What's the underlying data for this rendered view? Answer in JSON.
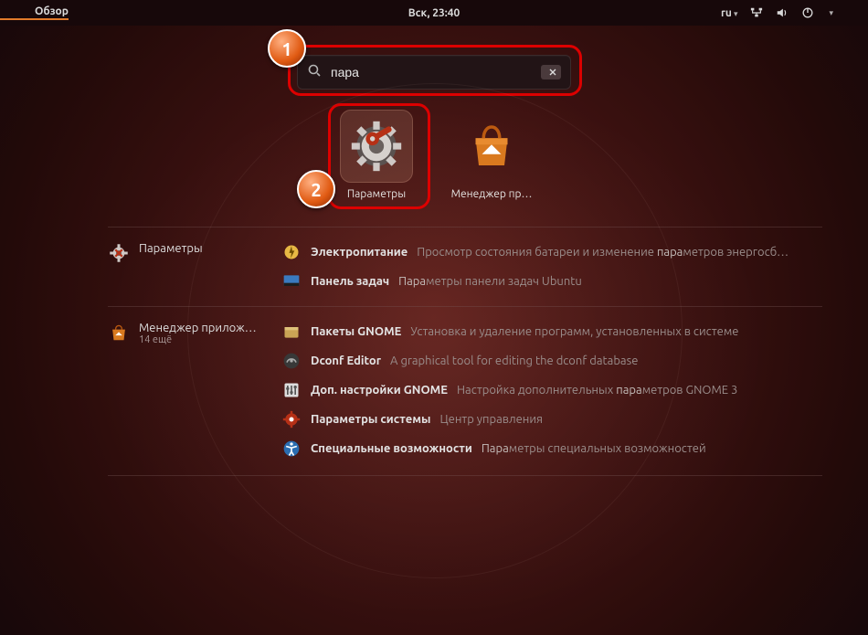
{
  "topbar": {
    "activities": "Обзор",
    "datetime": "Вск, 23:40",
    "lang": "ru"
  },
  "search": {
    "value": "пара"
  },
  "annotations": {
    "num1": "1",
    "num2": "2"
  },
  "apps": [
    {
      "name": "settings-app",
      "label": "Параметры"
    },
    {
      "name": "software-manager-app",
      "label": "Менеджер пр…"
    }
  ],
  "groups": [
    {
      "icon": "settings",
      "title": "Параметры",
      "subtitle": "",
      "items": [
        {
          "icon": "power",
          "title": "Электропитание",
          "desc": "Просмотр состояния батареи и изменение ",
          "hl": "пара",
          "desc2": "метров энергосб…"
        },
        {
          "icon": "panel",
          "title": "Панель задач",
          "descPre": "",
          "hl": "Пара",
          "desc2": "метры панели задач Ubuntu"
        }
      ]
    },
    {
      "icon": "software",
      "title": "Менеджер прилож…",
      "subtitle": "14 ещё",
      "items": [
        {
          "icon": "package",
          "title": "Пакеты GNOME",
          "desc": "Установка и удаление программ, установленных в системе"
        },
        {
          "icon": "dconf",
          "title": "Dconf Editor",
          "desc": "A graphical tool for editing the dconf database"
        },
        {
          "icon": "tweaks",
          "title": "Доп. настройки GNOME",
          "desc": "Настройка дополнительных ",
          "hl": "пара",
          "desc2": "метров GNOME 3"
        },
        {
          "icon": "cog",
          "title": "Параметры системы",
          "desc": "Центр управления"
        },
        {
          "icon": "a11y",
          "title": "Специальные возможности",
          "descPre": "",
          "hl": "Пара",
          "desc2": "метры специальных возможностей"
        }
      ]
    }
  ]
}
